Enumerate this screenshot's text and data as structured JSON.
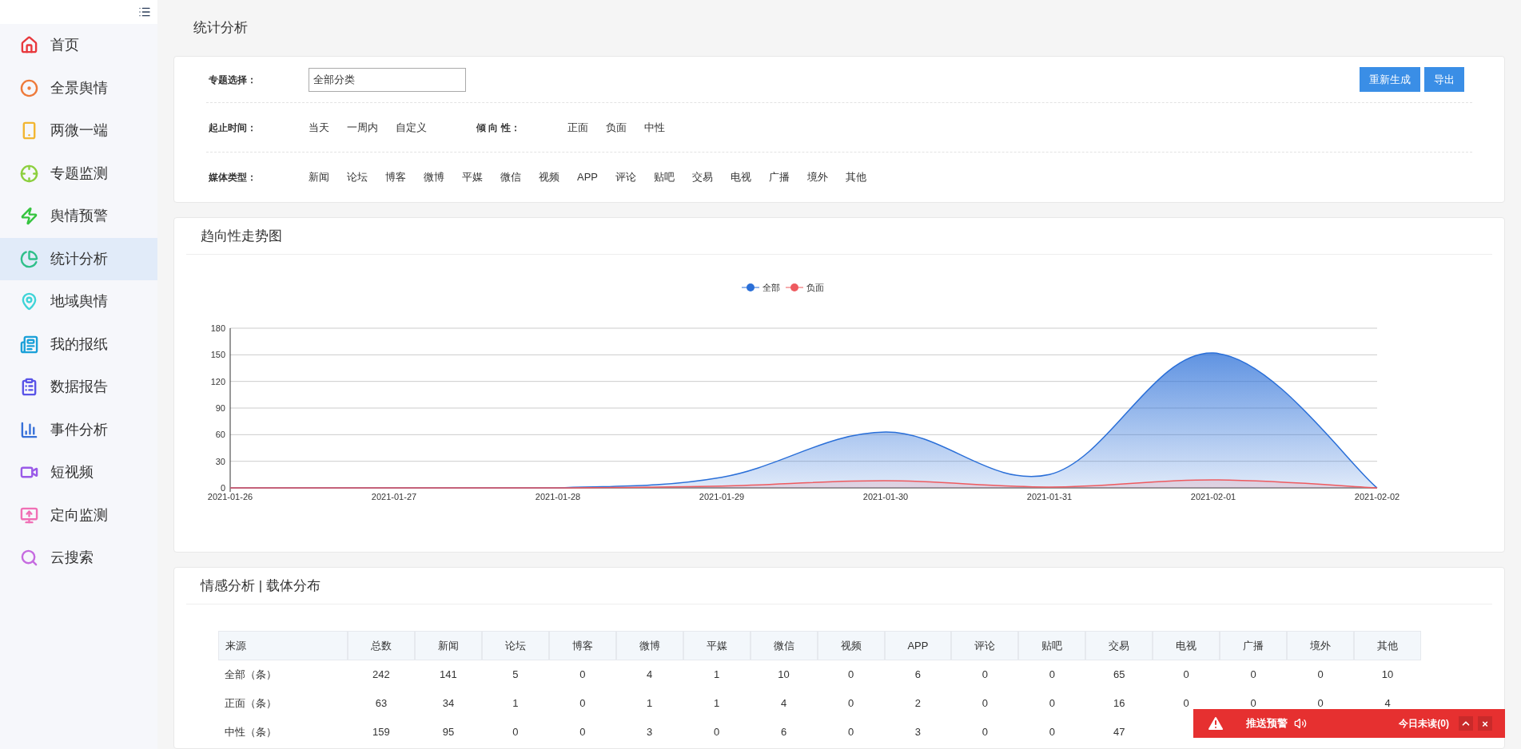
{
  "sidebar": {
    "items": [
      {
        "label": "首页",
        "color": "#e8383d",
        "selected": false
      },
      {
        "label": "全景舆情",
        "color": "#ee7a3a",
        "selected": false
      },
      {
        "label": "两微一端",
        "color": "#f2b632",
        "selected": false
      },
      {
        "label": "专题监测",
        "color": "#8ccf3e",
        "selected": false
      },
      {
        "label": "舆情预警",
        "color": "#35c43f",
        "selected": false
      },
      {
        "label": "统计分析",
        "color": "#2fbf8a",
        "selected": true
      },
      {
        "label": "地域舆情",
        "color": "#3fd4d8",
        "selected": false
      },
      {
        "label": "我的报纸",
        "color": "#1aa0d8",
        "selected": false
      },
      {
        "label": "数据报告",
        "color": "#5a54e8",
        "selected": false
      },
      {
        "label": "事件分析",
        "color": "#3670d8",
        "selected": false
      },
      {
        "label": "短视频",
        "color": "#9a5ae8",
        "selected": false
      },
      {
        "label": "定向监测",
        "color": "#f06fb5",
        "selected": false
      },
      {
        "label": "云搜索",
        "color": "#c66be0",
        "selected": false
      }
    ]
  },
  "page_title": "统计分析",
  "filters": {
    "topic": {
      "label": "专题选择：",
      "value": "全部分类"
    },
    "buttons": [
      "重新生成",
      "导出"
    ],
    "time": {
      "label": "起止时间：",
      "options": [
        "当天",
        "一周内",
        "自定义"
      ]
    },
    "tendency": {
      "label": "倾 向 性：",
      "options": [
        "正面",
        "负面",
        "中性"
      ]
    },
    "media": {
      "label": "媒体类型：",
      "options": [
        "新闻",
        "论坛",
        "博客",
        "微博",
        "平媒",
        "微信",
        "视频",
        "APP",
        "评论",
        "贴吧",
        "交易",
        "电视",
        "广播",
        "境外",
        "其他"
      ]
    }
  },
  "trend": {
    "title": "趋向性走势图",
    "chart_data": {
      "type": "area",
      "grid": true,
      "legend": true,
      "categories": [
        "2021-01-26",
        "2021-01-27",
        "2021-01-28",
        "2021-01-29",
        "2021-01-30",
        "2021-01-31",
        "2021-02-01",
        "2021-02-02"
      ],
      "ylim": [
        0,
        180
      ],
      "yticks": [
        0,
        30,
        60,
        90,
        120,
        150,
        180
      ],
      "series": [
        {
          "name": "全部",
          "color": "#2a6fd8",
          "values": [
            0,
            0,
            0,
            12,
            63,
            15,
            152,
            0
          ]
        },
        {
          "name": "负面",
          "color": "#ee5a5f",
          "values": [
            0,
            0,
            0,
            2,
            8,
            1,
            9,
            0
          ]
        }
      ]
    }
  },
  "distribution": {
    "title": "情感分析 | 载体分布",
    "columns": [
      "来源",
      "总数",
      "新闻",
      "论坛",
      "博客",
      "微博",
      "平媒",
      "微信",
      "视频",
      "APP",
      "评论",
      "贴吧",
      "交易",
      "电视",
      "广播",
      "境外",
      "其他"
    ],
    "rows": [
      [
        "全部（条）",
        "242",
        "141",
        "5",
        "0",
        "4",
        "1",
        "10",
        "0",
        "6",
        "0",
        "0",
        "65",
        "0",
        "0",
        "0",
        "10"
      ],
      [
        "正面（条）",
        "63",
        "34",
        "1",
        "0",
        "1",
        "1",
        "4",
        "0",
        "2",
        "0",
        "0",
        "16",
        "0",
        "0",
        "0",
        "4"
      ],
      [
        "中性（条）",
        "159",
        "95",
        "0",
        "0",
        "3",
        "0",
        "6",
        "0",
        "3",
        "0",
        "0",
        "47"
      ]
    ]
  },
  "alert": {
    "title": "推送预警",
    "unread": "今日未读(0)",
    "close": "×"
  }
}
